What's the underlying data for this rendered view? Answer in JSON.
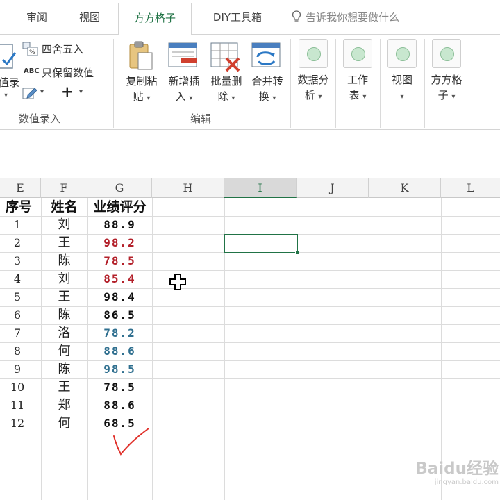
{
  "tabs": [
    {
      "label": "审阅"
    },
    {
      "label": "视图"
    },
    {
      "label": "方方格子",
      "active": true
    },
    {
      "label": "DIY工具箱"
    }
  ],
  "tell_me": "告诉我你想要做什么",
  "ribbon": {
    "left_partial_label": "值录",
    "round_label": "四舍五入",
    "keep_values_label": "只保留数值",
    "plus": "+",
    "group_value_entry": "数值录入",
    "edit_buttons": [
      {
        "line1": "复制粘",
        "line2": "贴"
      },
      {
        "line1": "新增插",
        "line2": "入"
      },
      {
        "line1": "批量删",
        "line2": "除"
      },
      {
        "line1": "合并转",
        "line2": "换"
      }
    ],
    "group_edit": "编辑",
    "right_buttons": [
      {
        "line1": "数据分",
        "line2": "析"
      },
      {
        "line1": "工作",
        "line2": "表"
      },
      {
        "line1": "视图",
        "line2": ""
      },
      {
        "line1": "方方格",
        "line2": "子"
      }
    ]
  },
  "columns": [
    "E",
    "F",
    "G",
    "H",
    "I",
    "J",
    "K",
    "L"
  ],
  "selected_column": "I",
  "table": {
    "headers": [
      "序号",
      "姓名",
      "业绩评分"
    ],
    "rows": [
      {
        "seq": "1",
        "name": "刘",
        "score": "88.9",
        "color": "#111111"
      },
      {
        "seq": "2",
        "name": "王",
        "score": "98.2",
        "color": "#b3202a"
      },
      {
        "seq": "3",
        "name": "陈",
        "score": "78.5",
        "color": "#b3202a"
      },
      {
        "seq": "4",
        "name": "刘",
        "score": "85.4",
        "color": "#b3202a"
      },
      {
        "seq": "5",
        "name": "王",
        "score": "98.4",
        "color": "#111111"
      },
      {
        "seq": "6",
        "name": "陈",
        "score": "86.5",
        "color": "#111111"
      },
      {
        "seq": "7",
        "name": "洛",
        "score": "78.2",
        "color": "#2f6f8f"
      },
      {
        "seq": "8",
        "name": "何",
        "score": "88.6",
        "color": "#2f6f8f"
      },
      {
        "seq": "9",
        "name": "陈",
        "score": "98.5",
        "color": "#2f6f8f"
      },
      {
        "seq": "10",
        "name": "王",
        "score": "78.5",
        "color": "#111111"
      },
      {
        "seq": "11",
        "name": "郑",
        "score": "88.6",
        "color": "#111111"
      },
      {
        "seq": "12",
        "name": "何",
        "score": "68.5",
        "color": "#111111"
      }
    ]
  },
  "accent_color": "#217346",
  "watermark": {
    "brand": "Baidu经验",
    "url": "jingyan.baidu.com"
  }
}
